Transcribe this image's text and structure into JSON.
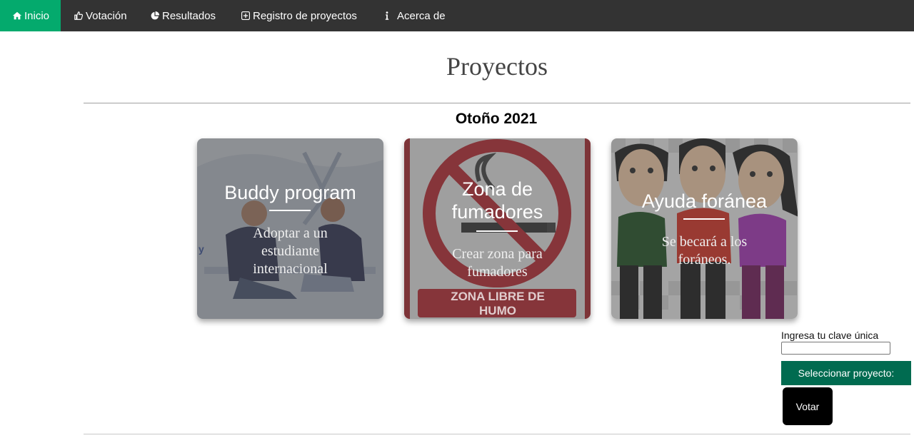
{
  "nav": {
    "items": [
      {
        "label": "Inicio",
        "icon": "home-icon",
        "active": true
      },
      {
        "label": "Votación",
        "icon": "thumbs-up-icon"
      },
      {
        "label": "Resultados",
        "icon": "pie-chart-icon"
      },
      {
        "label": "Registro de proyectos",
        "icon": "plus-square-icon"
      },
      {
        "label": "Acerca de",
        "icon": "info-icon"
      }
    ],
    "active_color": "#04aa6d",
    "bar_color": "#333333"
  },
  "page": {
    "title": "Proyectos",
    "section_title": "Otoño 2021"
  },
  "cards": [
    {
      "title": "Buddy program",
      "description": "Adoptar a un estudiante internacional",
      "image": "students-talking-illustration"
    },
    {
      "title": "Zona de fumadores",
      "description": "Crear zona para fumadores",
      "image": "no-smoking-sign",
      "sign_text": "ZONA LIBRE DE HUMO"
    },
    {
      "title": "Ayuda foránea",
      "description": "Se becará a los foráneos.",
      "image": "three-cartoon-students"
    }
  ],
  "vote_form": {
    "clave_label": "Ingresa tu clave única",
    "clave_value": "",
    "select_label": "Seleccionar proyecto:",
    "vote_label": "Votar",
    "select_color": "#006b50"
  }
}
